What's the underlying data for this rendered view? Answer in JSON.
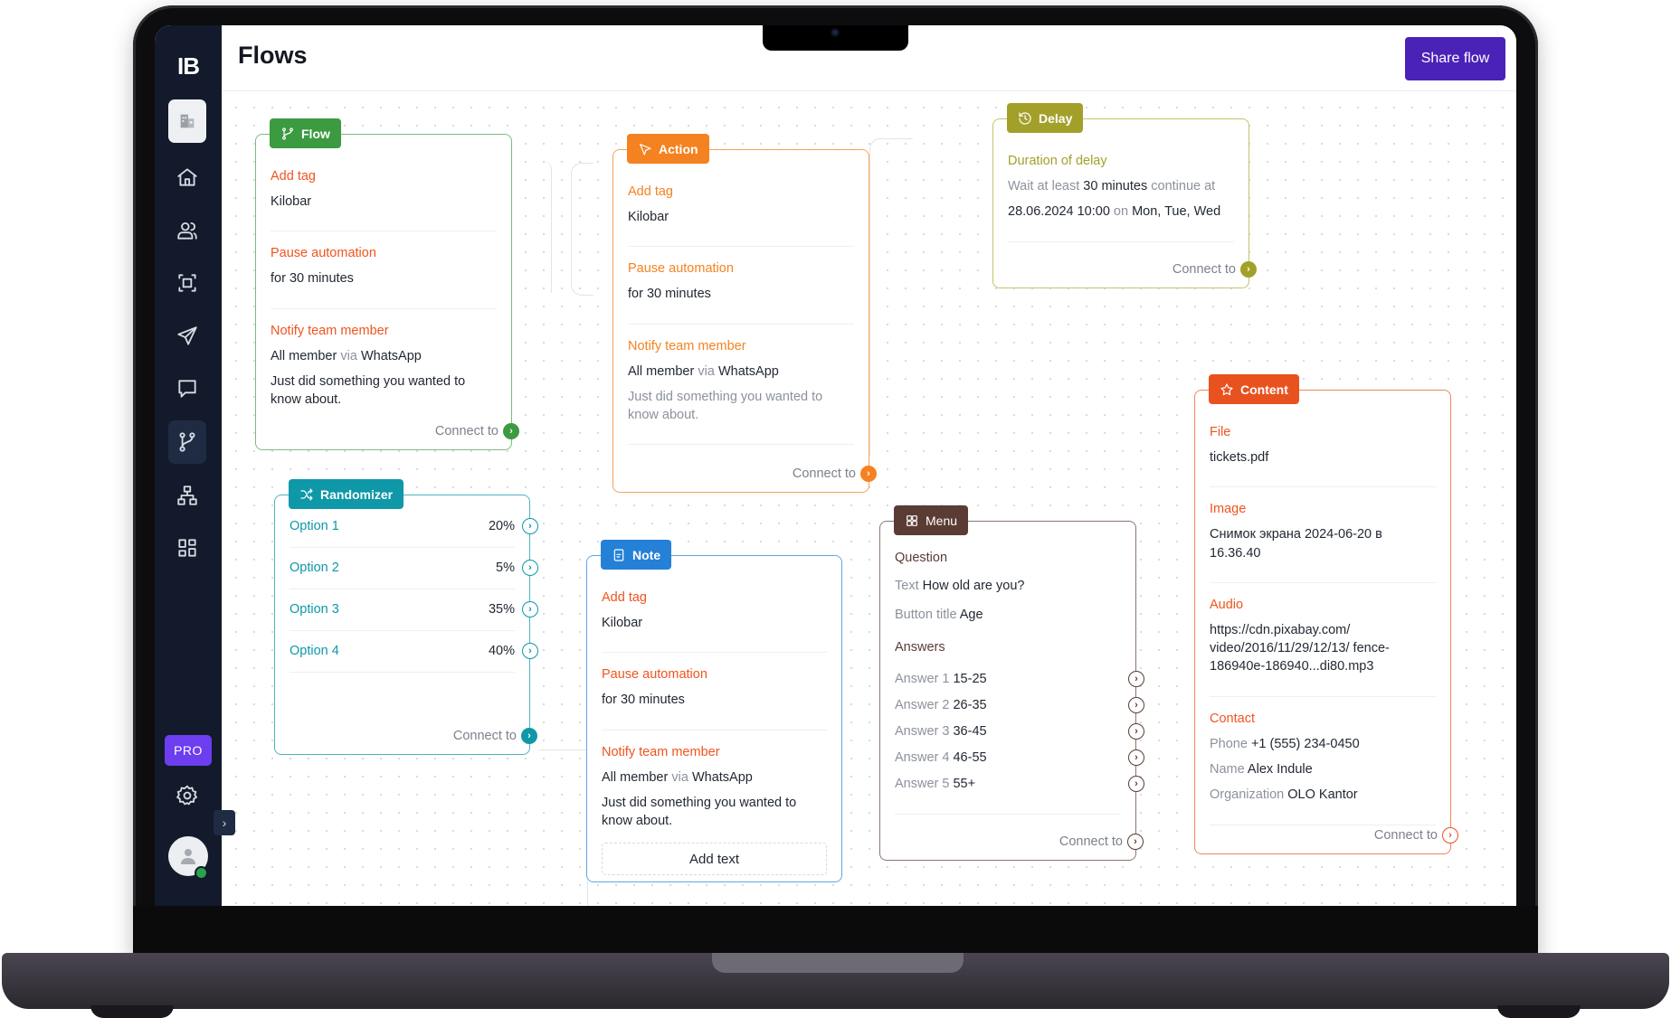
{
  "app": {
    "logo": "IB",
    "page_title": "Flows",
    "share_button": "Share flow",
    "plan_badge": "PRO"
  },
  "sidebar": {
    "items": [
      {
        "id": "workspace",
        "icon": "building-icon"
      },
      {
        "id": "home",
        "icon": "home-icon"
      },
      {
        "id": "contacts",
        "icon": "users-icon"
      },
      {
        "id": "scan",
        "icon": "focus-icon"
      },
      {
        "id": "broadcasts",
        "icon": "send-icon"
      },
      {
        "id": "chats",
        "icon": "message-icon"
      },
      {
        "id": "flows",
        "icon": "git-branch-icon",
        "active": true
      },
      {
        "id": "integrations",
        "icon": "sitemap-icon"
      },
      {
        "id": "apps",
        "icon": "grid-icon"
      }
    ],
    "settings_icon": "gear-icon",
    "expand_icon": "chevron-right-icon",
    "user_status": "online"
  },
  "colors": {
    "flow": "#3c9a41",
    "action": "#f58220",
    "delay": "#a3a02a",
    "content": "#e8521f",
    "randomizer": "#0e98a8",
    "note": "#2580d7",
    "menu": "#5a3c34",
    "label_orange": "#f0541e",
    "share": "#4b22b8",
    "pro": "#6d3df0"
  },
  "connect_label": "Connect to",
  "nodes": {
    "flow": {
      "tag": "Flow",
      "sections": [
        {
          "label": "Add tag",
          "value": "Kilobar"
        },
        {
          "label": "Pause automation",
          "value": "for 30 minutes"
        },
        {
          "label": "Notify team member",
          "who": "All member",
          "via": "via",
          "channel": "WhatsApp",
          "message": "Just did something you wanted to know about."
        }
      ]
    },
    "action": {
      "tag": "Action",
      "sections": [
        {
          "label": "Add tag",
          "value": "Kilobar"
        },
        {
          "label": "Pause automation",
          "value": "for 30 minutes"
        },
        {
          "label": "Notify team member",
          "who": "All member",
          "via": "via",
          "channel": "WhatsApp",
          "message": "Just did something you wanted to know about."
        }
      ]
    },
    "delay": {
      "tag": "Delay",
      "label": "Duration of delay",
      "wait_prefix": "Wait at least",
      "duration": "30 minutes",
      "continue_text": "continue at",
      "datetime": "28.06.2024 10:00",
      "on_text": "on",
      "days": "Mon, Tue, Wed"
    },
    "content": {
      "tag": "Content",
      "file_label": "File",
      "file": "tickets.pdf",
      "image_label": "Image",
      "image": "Снимок экрана 2024-06-20 в 16.36.40",
      "audio_label": "Audio",
      "audio": "https://cdn.pixabay.com/ video/2016/11/29/12/13/ fence-186940e-186940...di80.mp3",
      "contact_label": "Contact",
      "phone_key": "Phone",
      "phone": "+1 (555) 234-0450",
      "name_key": "Name",
      "name": "Alex Indule",
      "org_key": "Organization",
      "org": "OLO Kantor"
    },
    "randomizer": {
      "tag": "Randomizer",
      "options": [
        {
          "label": "Option 1",
          "percent": "20%"
        },
        {
          "label": "Option 2",
          "percent": "5%"
        },
        {
          "label": "Option 3",
          "percent": "35%"
        },
        {
          "label": "Option 4",
          "percent": "40%"
        }
      ]
    },
    "note": {
      "tag": "Note",
      "sections": [
        {
          "label": "Add tag",
          "value": "Kilobar"
        },
        {
          "label": "Pause automation",
          "value": "for 30 minutes"
        },
        {
          "label": "Notify team member",
          "who": "All member",
          "via": "via",
          "channel": "WhatsApp",
          "message": "Just did something you wanted to know about."
        }
      ],
      "add_text_button": "Add text"
    },
    "menu": {
      "tag": "Menu",
      "question_label": "Question",
      "text_key": "Text",
      "text_value": "How old are you?",
      "button_key": "Button title",
      "button_value": "Age",
      "answers_label": "Answers",
      "answers": [
        {
          "key": "Answer 1",
          "value": "15-25"
        },
        {
          "key": "Answer 2",
          "value": "26-35"
        },
        {
          "key": "Answer 3",
          "value": "36-45"
        },
        {
          "key": "Answer 4",
          "value": "46-55"
        },
        {
          "key": "Answer 5",
          "value": "55+"
        }
      ]
    }
  }
}
